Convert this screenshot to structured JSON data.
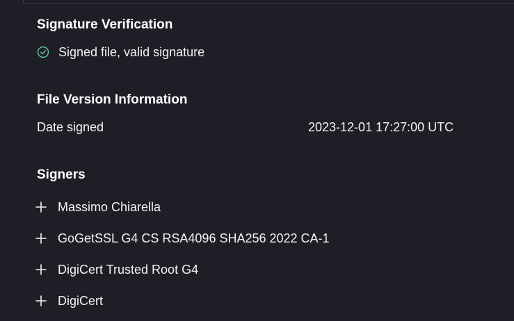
{
  "signature_verification": {
    "heading": "Signature Verification",
    "status_icon": "check-circle-icon",
    "status_color": "#5ec79b",
    "status_text": "Signed file, valid signature"
  },
  "file_version": {
    "heading": "File Version Information",
    "rows": [
      {
        "key": "Date signed",
        "value": "2023-12-01 17:27:00 UTC"
      }
    ]
  },
  "signers": {
    "heading": "Signers",
    "expand_icon": "plus-icon",
    "items": [
      {
        "name": "Massimo Chiarella"
      },
      {
        "name": "GoGetSSL G4 CS RSA4096 SHA256 2022 CA-1"
      },
      {
        "name": "DigiCert Trusted Root G4"
      },
      {
        "name": "DigiCert"
      }
    ]
  }
}
